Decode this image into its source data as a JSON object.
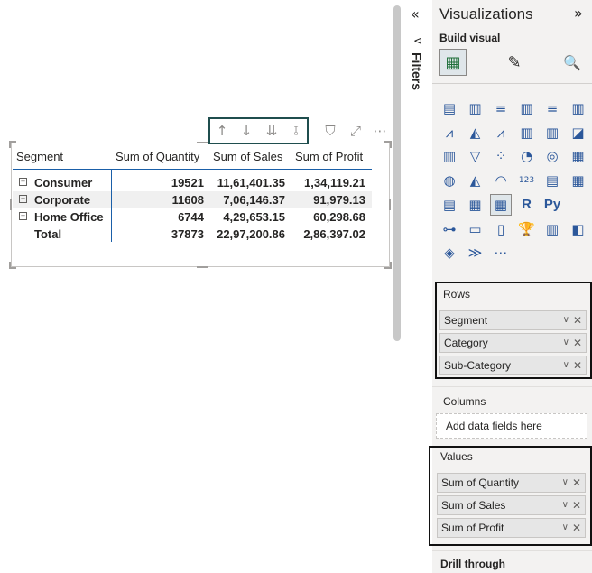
{
  "toolbar": {
    "icons": [
      "drill-up-icon",
      "drill-down-icon",
      "go-to-next-level-icon",
      "expand-hierarchy-icon",
      "filter-icon",
      "focus-mode-icon",
      "more-options-icon"
    ],
    "glyphs": [
      "↑",
      "↓",
      "⇊",
      "⫱",
      "⛉",
      "⤢",
      "⋯"
    ]
  },
  "matrix": {
    "headers": [
      "Segment",
      "Sum of Quantity",
      "Sum of Sales",
      "Sum of Profit"
    ],
    "rows": [
      {
        "segment": "Consumer",
        "quantity": "19521",
        "sales": "11,61,401.35",
        "profit": "1,34,119.21"
      },
      {
        "segment": "Corporate",
        "quantity": "11608",
        "sales": "7,06,146.37",
        "profit": "91,979.13"
      },
      {
        "segment": "Home Office",
        "quantity": "6744",
        "sales": "4,29,653.15",
        "profit": "60,298.68"
      }
    ],
    "total": {
      "segment": "Total",
      "quantity": "37873",
      "sales": "22,97,200.86",
      "profit": "2,86,397.02"
    },
    "expand_glyph": "+"
  },
  "filters": {
    "label": "Filters",
    "collapse_glyph": "«",
    "icon_glyph": "⊲"
  },
  "viz": {
    "title": "Visualizations",
    "expand_glyph": "»",
    "build_visual": "Build visual",
    "tab_glyphs": [
      "▦",
      "✎",
      "🔍"
    ]
  },
  "grid_icons": [
    [
      "▤",
      "▥",
      "≡",
      "▥",
      "≡",
      "▥"
    ],
    [
      "⩘",
      "◭",
      "⩘",
      "▥",
      "▥",
      "◪"
    ],
    [
      "▥",
      "▽",
      "⁘",
      "◔",
      "◎",
      "▦"
    ],
    [
      "◍",
      "◭",
      "◠",
      "123",
      "▤",
      "▦"
    ],
    [
      "▤",
      "▦",
      "▦",
      "R",
      "Py",
      ""
    ],
    [
      "⊶",
      "▭",
      "▯",
      "🏆",
      "▥",
      "◧"
    ],
    [
      "◈",
      "≫",
      "⋯",
      "",
      "",
      ""
    ]
  ],
  "wells": {
    "rows_label": "Rows",
    "rows_fields": [
      "Segment",
      "Category",
      "Sub-Category"
    ],
    "columns_label": "Columns",
    "columns_placeholder": "Add data fields here",
    "values_label": "Values",
    "values_fields": [
      "Sum of Quantity",
      "Sum of Sales",
      "Sum of Profit"
    ],
    "drill_through_label": "Drill through",
    "chevron_glyph": "∨",
    "remove_glyph": "✕"
  },
  "colors": {
    "accent": "#1a5fa8",
    "pane_bg": "#f3f2f1",
    "highlight_box": "#1f4e4e"
  }
}
